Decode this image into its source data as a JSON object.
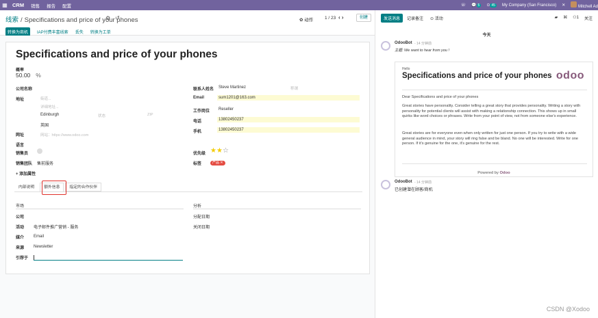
{
  "topbar": {
    "app_name": "CRM",
    "menus": [
      "销售",
      "报告",
      "配置"
    ],
    "chat_badge": "5",
    "activity_badge": "45",
    "company": "My Company (San Francisco)",
    "user": "Mitchell Ad"
  },
  "breadcrumb": {
    "root": "线索",
    "sep": "/",
    "current": "Specifications and price of your phones"
  },
  "control": {
    "actions": "✿ 动作",
    "pager": "1 / 23",
    "create": "创建"
  },
  "statusbar": {
    "convert_opportunity": "转换为商机",
    "iap_enrich": "IAP付费丰富线索",
    "lost": "丢失",
    "convert_ticket": "转换为工单"
  },
  "form": {
    "title": "Specifications and price of your phones",
    "probability_label": "概率",
    "probability_value": "50.00",
    "probability_unit": "%",
    "company_label": "公司名称",
    "address_label": "地址",
    "street_ph": "街道...",
    "street2_ph": "详细地址...",
    "city": "Edinburgh",
    "state_ph": "状态",
    "zip_ph": "ZIP",
    "country": "英国",
    "website_label": "网址",
    "website_ph": "网站：https://www.odoo.com",
    "language_label": "语言",
    "salesperson_label": "销售员",
    "salesteam_label": "销售团队",
    "salesteam_value": "售前服务",
    "add_property": "+ 添加属性",
    "contact_label": "联系人姓名",
    "contact_value": "Steve Martinez",
    "title_ph": "称谓",
    "email_label": "Email",
    "email_value": "sum1201@163.com",
    "job_label": "工作岗位",
    "job_value": "Reseller",
    "phone_label": "电话",
    "phone_value": "13802450237",
    "mobile_label": "手机",
    "mobile_value": "13802450237",
    "priority_label": "优先级",
    "priority_stars": 2,
    "tags_label": "标签",
    "tag_value": "产品 ✕"
  },
  "tabs": [
    "内部说明",
    "额外信息",
    "指定的合作伙伴"
  ],
  "extra": {
    "marketing_header": "市场",
    "company_label": "公司",
    "campaign_label": "活动",
    "campaign_value": "电子邮件推广营销 - 服务",
    "medium_label": "媒介",
    "medium_value": "Email",
    "source_label": "来源",
    "source_value": "Newsletter",
    "referred_label": "引荐于",
    "analysis_header": "分析",
    "assign_date_label": "分配日期",
    "close_date_label": "关闭日期"
  },
  "chatter": {
    "send_message": "发送消息",
    "log_note": "记录备注",
    "activities": "⊙ 活动",
    "followers_count": "1",
    "follow": "关注",
    "today": "今天",
    "msg1_author": "OdooBot",
    "msg1_date": "- 14 分钟前",
    "msg1_subject": "主题: We want to hear from you !",
    "email_hello": "Hello",
    "email_heading": "Specifications and price of your phones",
    "email_logo": "odoo",
    "email_p1": "Dear Specifications and price of your phones",
    "email_p2": "Great stories have personality. Consider telling a great story that provides personality. Writing a story with personality for potential clients will assist with making a relationship connection. This shows up in small quirks like word choices or phrases. Write from your point of view, not from someone else's experience.",
    "email_p3": "Great stories are for everyone even when only written for just one person. If you try to write with a wide general audience in mind, your story will ring false and be bland. No one will be interested. Write for one person. If it's genuine for the one, it's genuine for the rest.",
    "powered_prefix": "Powered by",
    "powered_brand": "Odoo",
    "msg2_author": "OdooBot",
    "msg2_date": "- 14 分钟前",
    "msg2_body": "已创建潜在顾客/商机"
  },
  "watermark": "CSDN @Xodoo"
}
